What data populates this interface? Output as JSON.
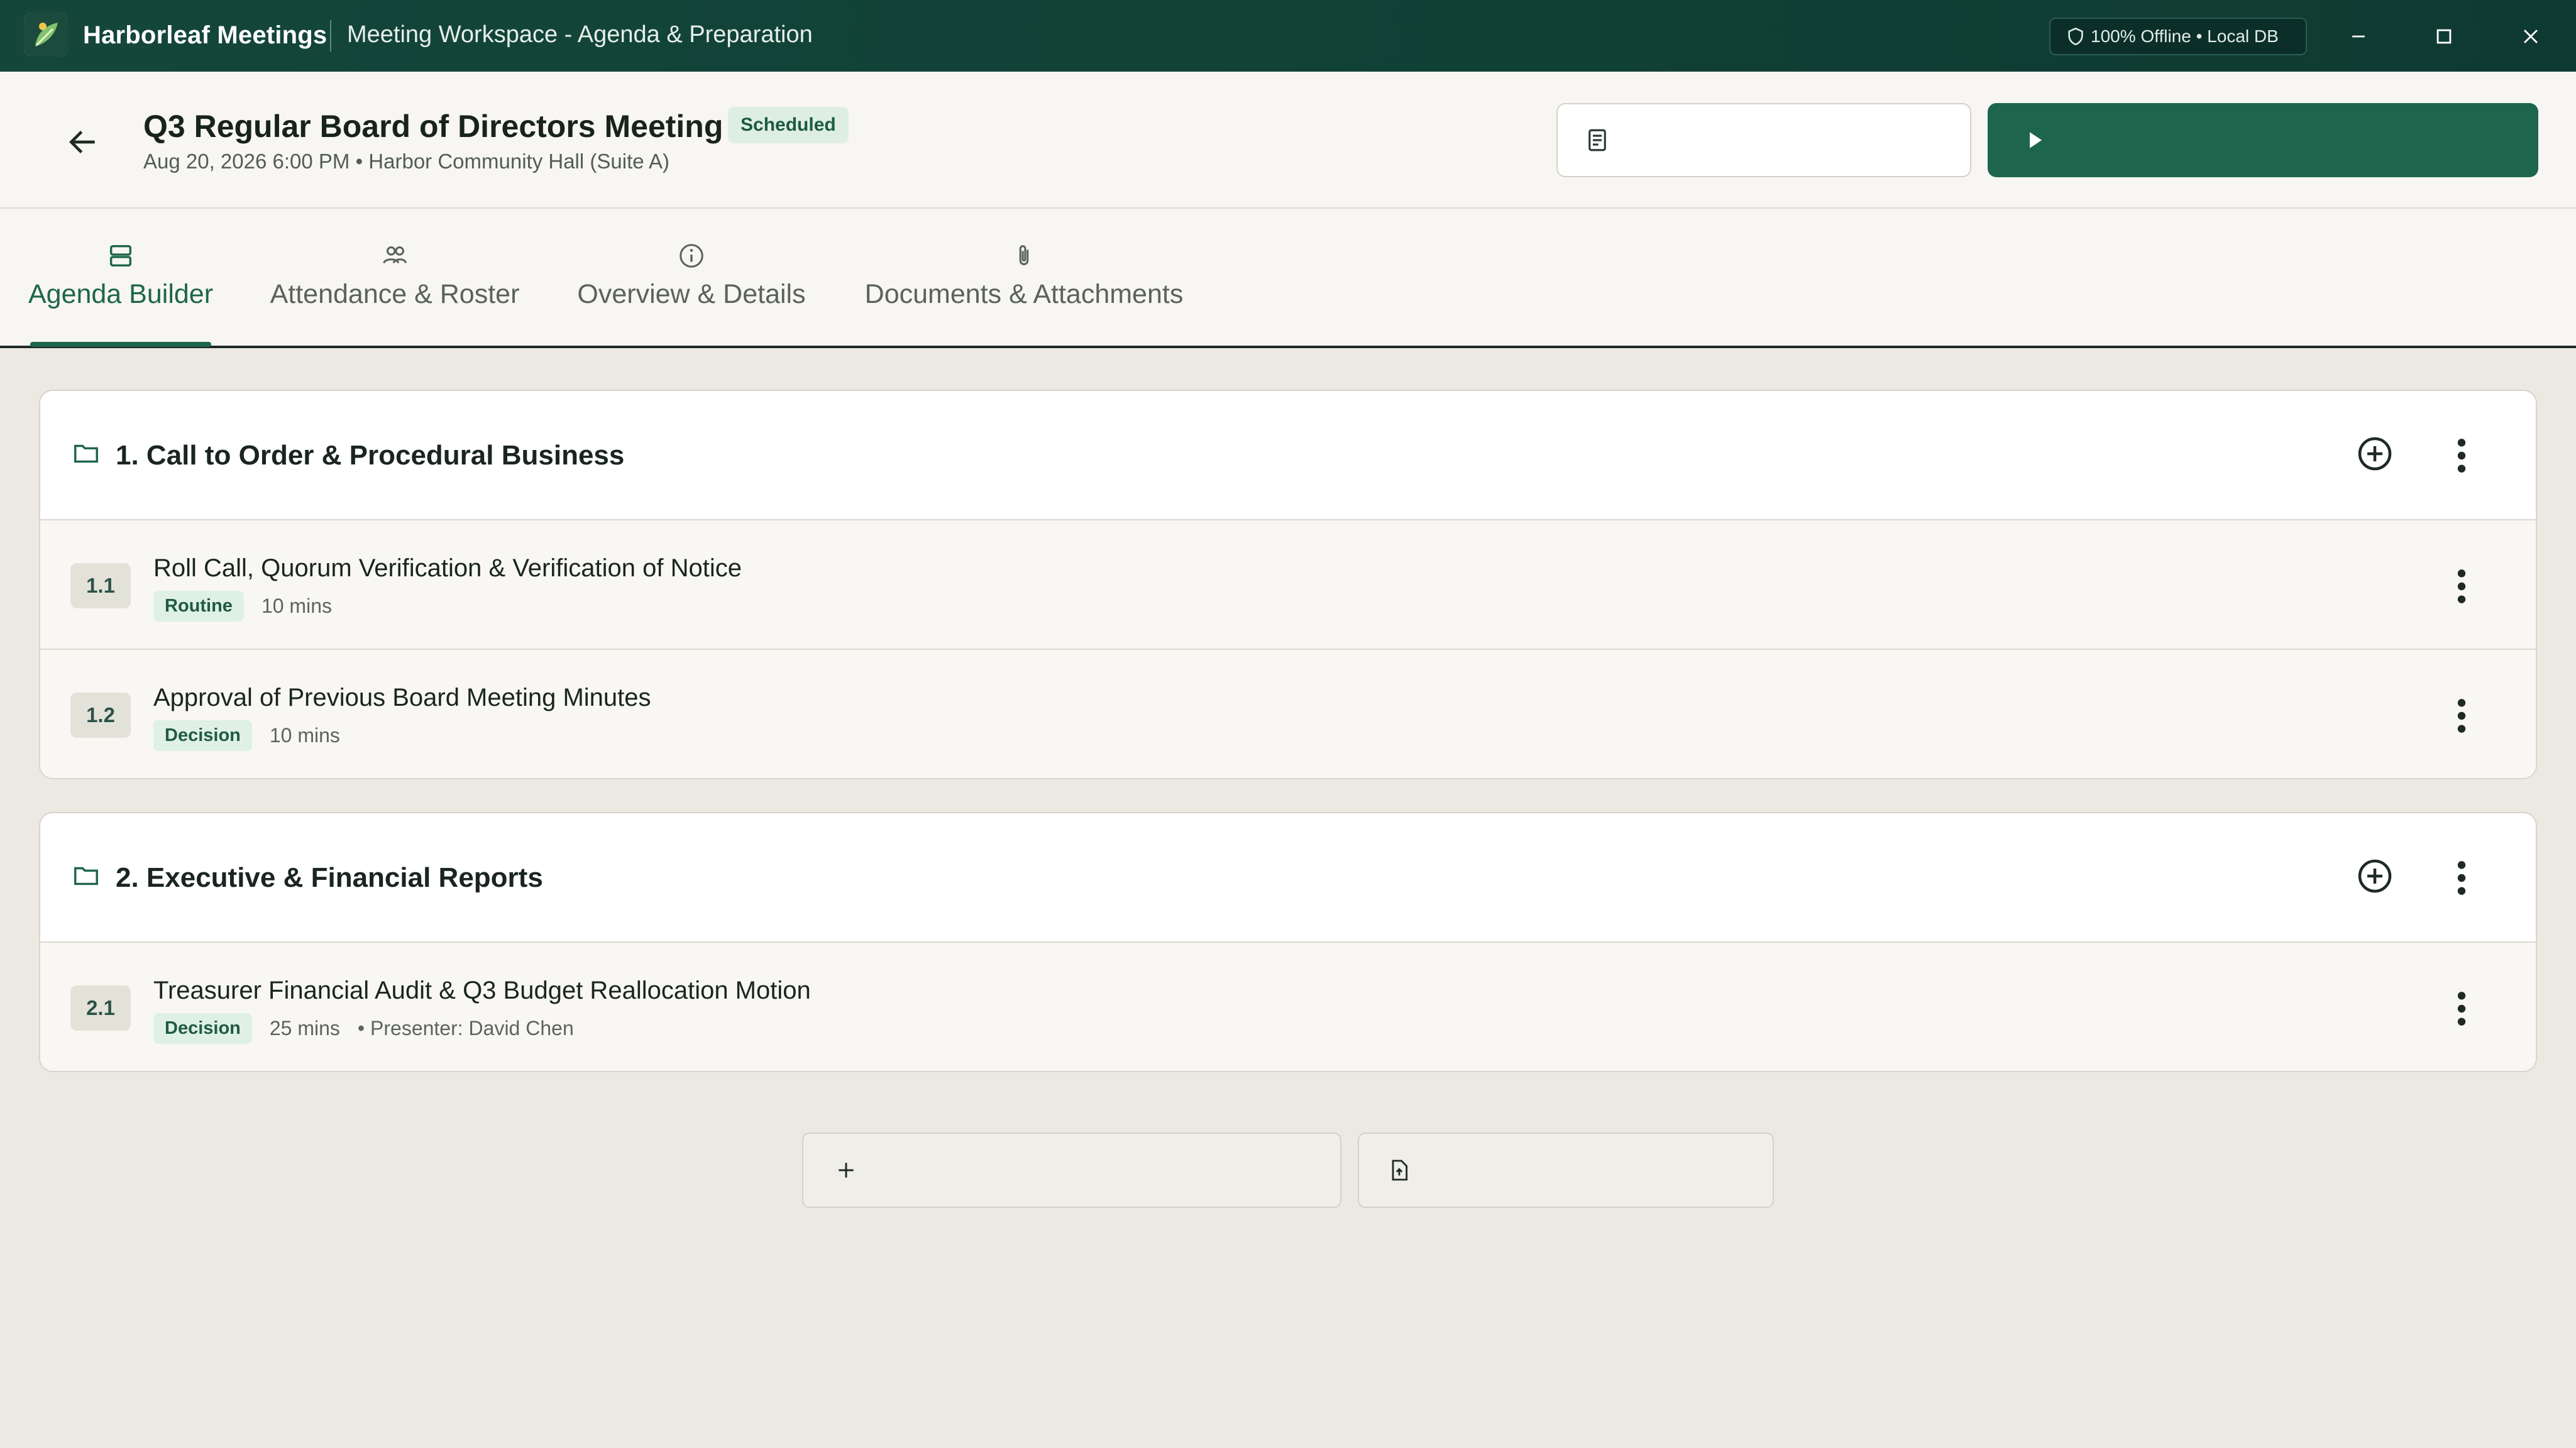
{
  "titlebar": {
    "app_name": "Harborleaf Meetings",
    "window_title": "Meeting Workspace - Agenda & Preparation",
    "offline_status": "100% Offline • Local DB",
    "controls": {
      "minimize_icon": "minimize-icon",
      "maximize_icon": "maximize-icon",
      "close_icon": "close-icon"
    }
  },
  "header": {
    "title": "Q3 Regular Board of Directors Meeting",
    "status": "Scheduled",
    "subtitle": "Aug 20, 2026 6:00 PM • Harbor Community Hall (Suite A)",
    "secondary_button": {
      "icon": "document-icon",
      "label": ""
    },
    "primary_button": {
      "icon": "play-icon",
      "label": ""
    }
  },
  "tabs": [
    {
      "label": "Agenda Builder",
      "icon": "agenda-icon",
      "active": true
    },
    {
      "label": "Attendance & Roster",
      "icon": "people-icon",
      "active": false
    },
    {
      "label": "Overview & Details",
      "icon": "info-icon",
      "active": false
    },
    {
      "label": "Documents & Attachments",
      "icon": "paperclip-icon",
      "active": false
    }
  ],
  "sections": [
    {
      "title": "1. Call to Order & Procedural Business",
      "items": [
        {
          "number": "1.1",
          "title": "Roll Call, Quorum Verification & Verification of Notice",
          "tag": "Routine",
          "duration": "10 mins",
          "presenter": ""
        },
        {
          "number": "1.2",
          "title": "Approval of Previous Board Meeting Minutes",
          "tag": "Decision",
          "duration": "10 mins",
          "presenter": ""
        }
      ]
    },
    {
      "title": "2. Executive & Financial Reports",
      "items": [
        {
          "number": "2.1",
          "title": "Treasurer Financial Audit & Q3 Budget Reallocation Motion",
          "tag": "Decision",
          "duration": "25 mins",
          "presenter": "• Presenter: David Chen"
        }
      ]
    }
  ],
  "bottom_actions": {
    "add_section": {
      "icon": "plus-icon",
      "label": ""
    },
    "import": {
      "icon": "file-upload-icon",
      "label": ""
    }
  },
  "colors": {
    "brand": "#1e654e",
    "titlebar": "#14463a",
    "tag_bg": "#dff0e4"
  }
}
